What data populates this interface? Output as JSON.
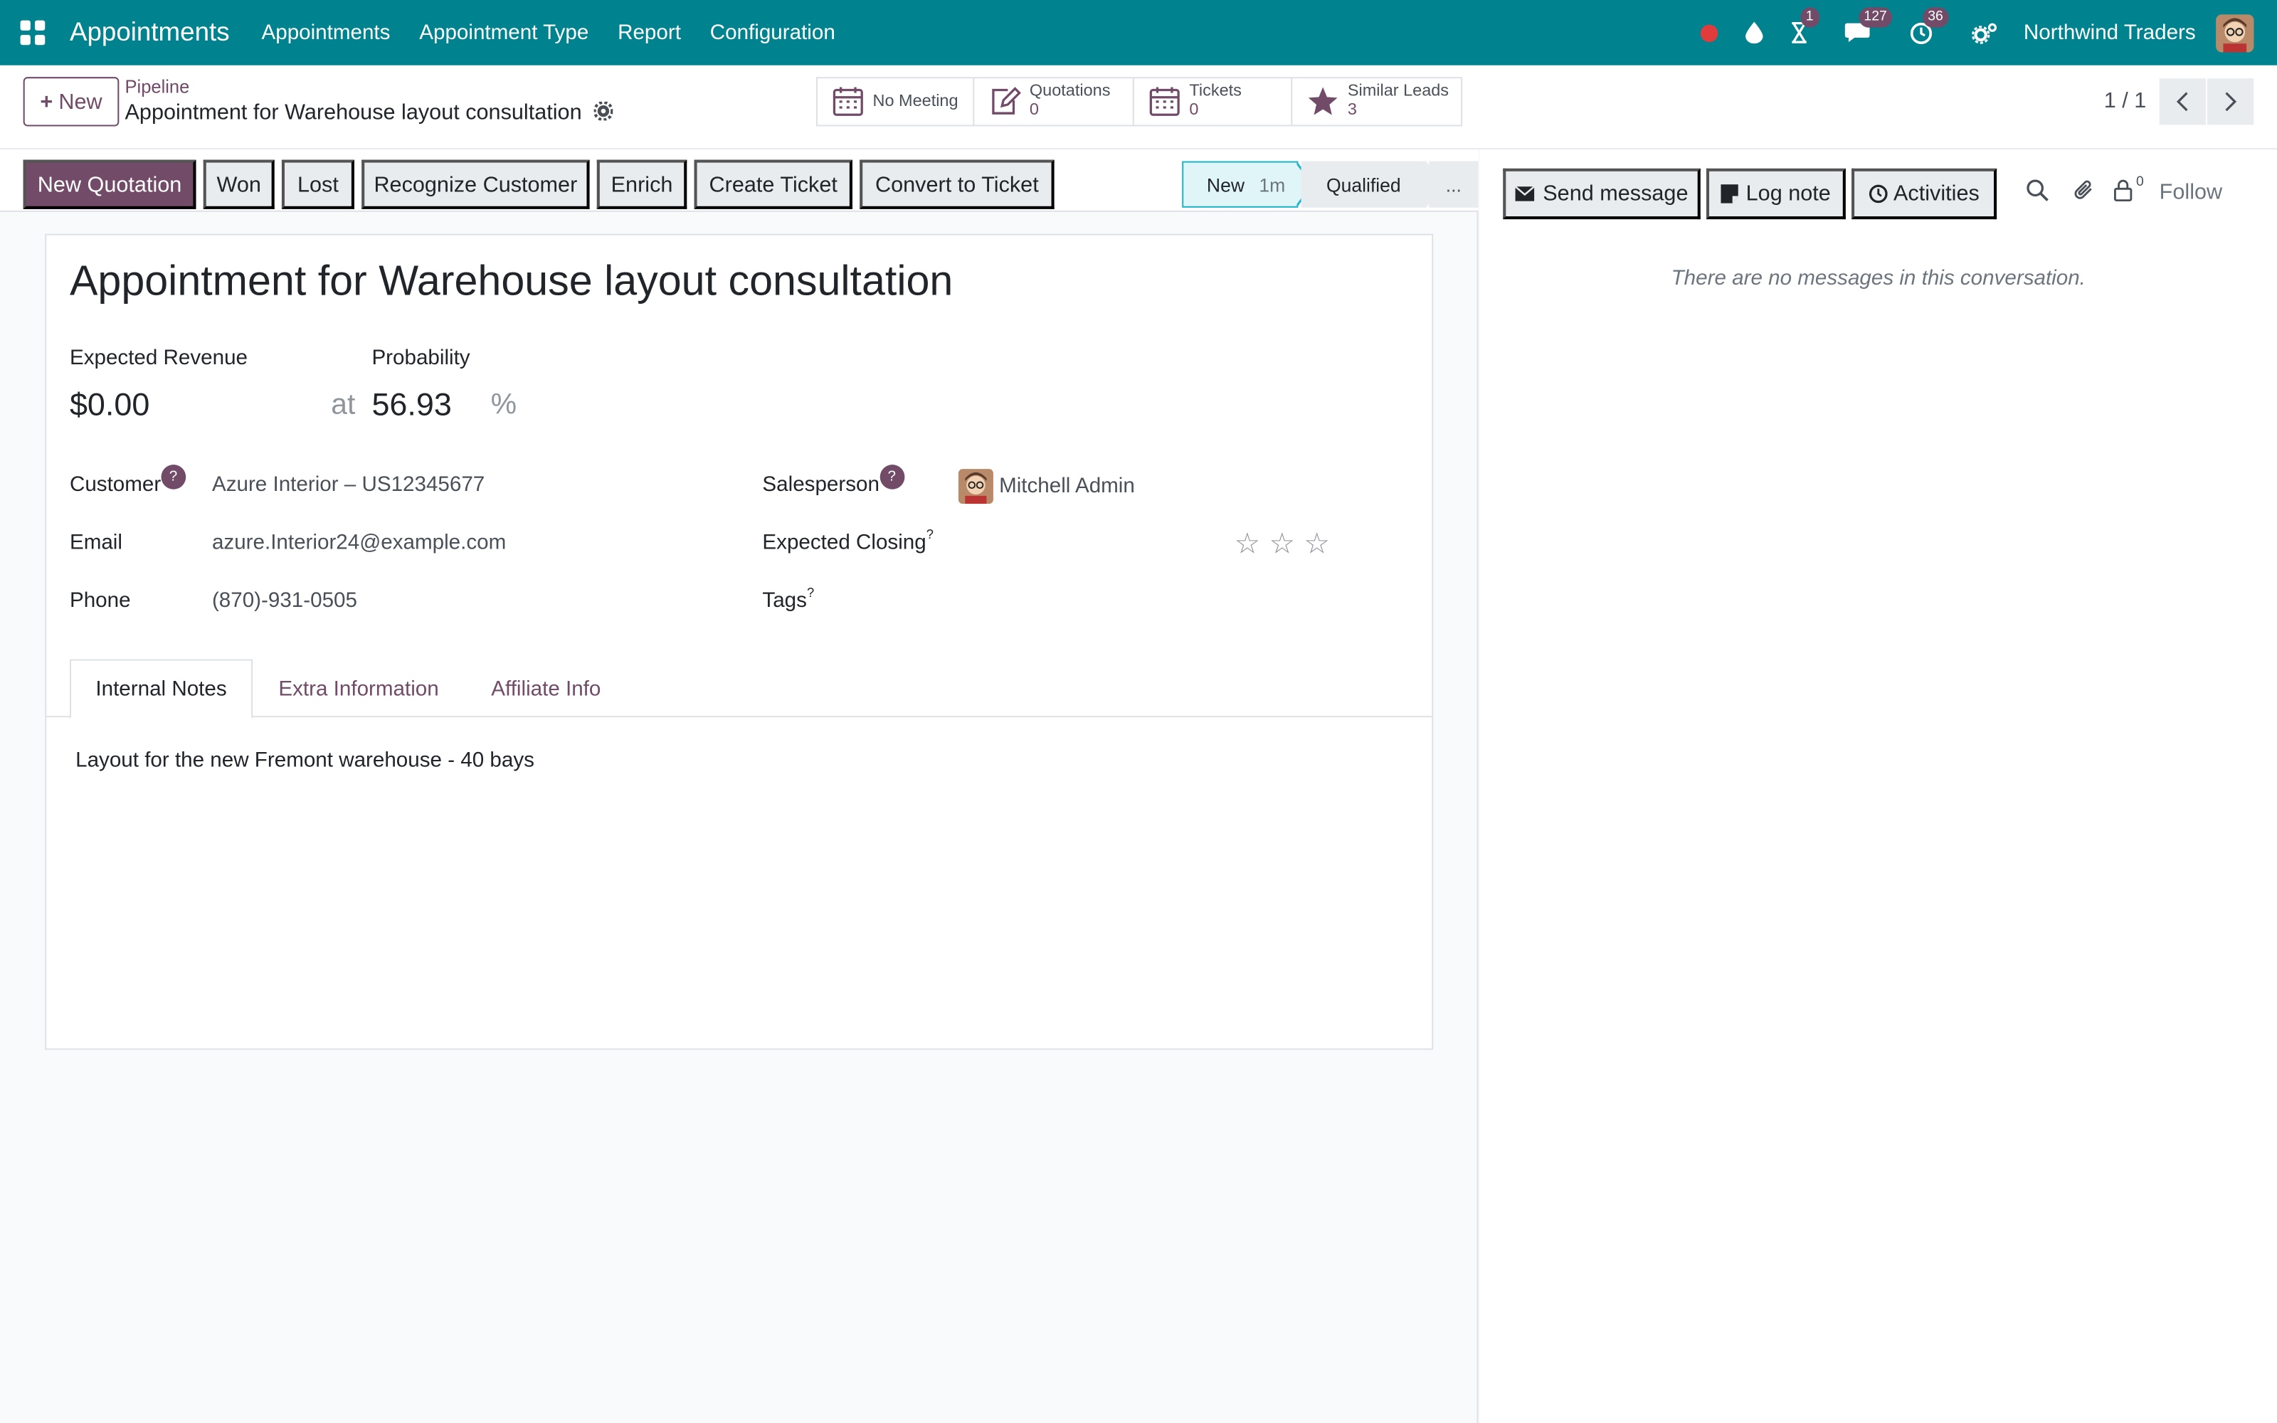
{
  "navbar": {
    "app_title": "Appointments",
    "menu": [
      "Appointments",
      "Appointment Type",
      "Report",
      "Configuration"
    ],
    "badges": {
      "activities": "1",
      "messages": "127",
      "clock": "36"
    },
    "company": "Northwind Traders"
  },
  "control_panel": {
    "new_label": "New",
    "breadcrumb_parent": "Pipeline",
    "breadcrumb_current": "Appointment for Warehouse layout consultation",
    "smart_buttons": {
      "meeting": {
        "title": "No Meeting"
      },
      "quotations": {
        "title": "Quotations",
        "value": "0"
      },
      "tickets": {
        "title": "Tickets",
        "value": "0"
      },
      "similar": {
        "title": "Similar Leads",
        "value": "3"
      }
    },
    "pager": "1 / 1"
  },
  "actions": {
    "new_quotation": "New Quotation",
    "won": "Won",
    "lost": "Lost",
    "recognize": "Recognize Customer",
    "enrich": "Enrich",
    "create_ticket": "Create Ticket",
    "convert_ticket": "Convert to Ticket"
  },
  "stages": {
    "new": "New",
    "new_duration": "1m",
    "qualified": "Qualified",
    "more": "..."
  },
  "form": {
    "title": "Appointment for Warehouse layout consultation",
    "expected_revenue_label": "Expected Revenue",
    "expected_revenue": "$0.00",
    "at": "at",
    "probability_label": "Probability",
    "probability": "56.93",
    "percent": "%",
    "customer_label": "Customer",
    "customer": "Azure Interior – US12345677",
    "email_label": "Email",
    "email": "azure.Interior24@example.com",
    "phone_label": "Phone",
    "phone": "(870)-931-0505",
    "salesperson_label": "Salesperson",
    "salesperson": "Mitchell Admin",
    "expected_closing_label": "Expected Closing",
    "tags_label": "Tags",
    "help_mark": "?",
    "priority_stars": 0
  },
  "tabs": {
    "internal_notes": "Internal Notes",
    "extra_info": "Extra Information",
    "affiliate": "Affiliate Info"
  },
  "notes": "Layout for the new Fremont warehouse - 40 bays",
  "chatter": {
    "send_message": "Send message",
    "log_note": "Log note",
    "activities": "Activities",
    "followers_count": "0",
    "follow": "Follow",
    "empty": "There are no messages in this conversation."
  },
  "colors": {
    "navbar": "#00838f",
    "primary": "#714b67",
    "stage_active": "#e0f5f7"
  }
}
